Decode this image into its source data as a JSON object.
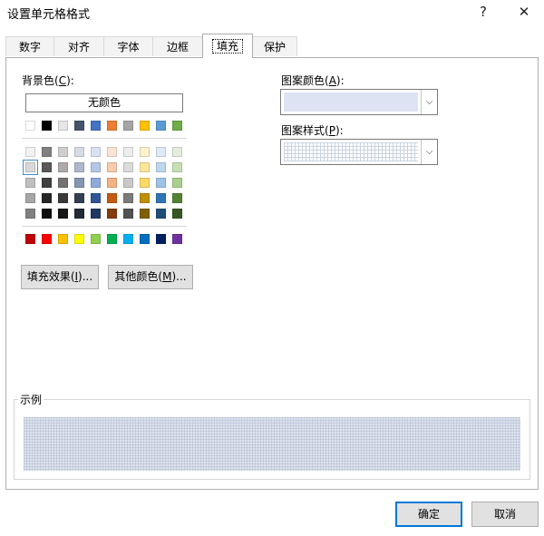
{
  "window": {
    "title": "设置单元格格式",
    "help_glyph": "?",
    "close_glyph": "✕"
  },
  "tabs": [
    {
      "label": "数字",
      "active": false
    },
    {
      "label": "对齐",
      "active": false
    },
    {
      "label": "字体",
      "active": false
    },
    {
      "label": "边框",
      "active": false
    },
    {
      "label": "填充",
      "active": true
    },
    {
      "label": "保护",
      "active": false
    }
  ],
  "background": {
    "label_pre": "背景色(",
    "label_key": "C",
    "label_post": "):",
    "no_color_label": "无颜色",
    "row_top": [
      "#ffffff",
      "#000000",
      "#e7e6e6",
      "#44546a",
      "#4472c4",
      "#ed7d31",
      "#a5a5a5",
      "#ffc000",
      "#5b9bd5",
      "#70ad47"
    ],
    "tint_rows": [
      [
        "#f2f2f2",
        "#808080",
        "#d0cece",
        "#d6dce5",
        "#d9e2f3",
        "#fbe4d5",
        "#ededed",
        "#fff2cc",
        "#deebf7",
        "#e2efda"
      ],
      [
        "#d9d9d9",
        "#595959",
        "#aeaaaa",
        "#adb9ca",
        "#b4c7e7",
        "#f8cbad",
        "#dbdbdb",
        "#ffe699",
        "#bdd7ee",
        "#c6e0b4"
      ],
      [
        "#bfbfbf",
        "#404040",
        "#757171",
        "#8497b0",
        "#8eaadb",
        "#f4b183",
        "#c9c9c9",
        "#ffd966",
        "#9dc3e6",
        "#a9d08e"
      ],
      [
        "#a6a6a6",
        "#262626",
        "#3a3838",
        "#333f50",
        "#2f5597",
        "#c55a11",
        "#7b7b7b",
        "#bf9000",
        "#2e75b6",
        "#548235"
      ],
      [
        "#808080",
        "#0d0d0d",
        "#171616",
        "#222a35",
        "#1f3864",
        "#843c0c",
        "#525252",
        "#7f6000",
        "#1f4e79",
        "#385723"
      ]
    ],
    "standard": [
      "#c00000",
      "#ff0000",
      "#ffc000",
      "#ffff00",
      "#92d050",
      "#00b050",
      "#00b0f0",
      "#0070c0",
      "#002060",
      "#7030a0"
    ],
    "selected": {
      "row": 1,
      "col": 0
    }
  },
  "buttons": {
    "fill_effects_pre": "填充效果(",
    "fill_effects_key": "I",
    "fill_effects_post": ")...",
    "more_colors_pre": "其他颜色(",
    "more_colors_key": "M",
    "more_colors_post": ")..."
  },
  "pattern_color": {
    "label_pre": "图案颜色(",
    "label_key": "A",
    "label_post": "):",
    "value_color": "#dde3f3",
    "arrow_glyph": "⌵"
  },
  "pattern_style": {
    "label_pre": "图案样式(",
    "label_key": "P",
    "label_post": "):",
    "arrow_glyph": "⌵"
  },
  "sample": {
    "label": "示例"
  },
  "footer": {
    "ok_label": "确定",
    "cancel_label": "取消"
  }
}
